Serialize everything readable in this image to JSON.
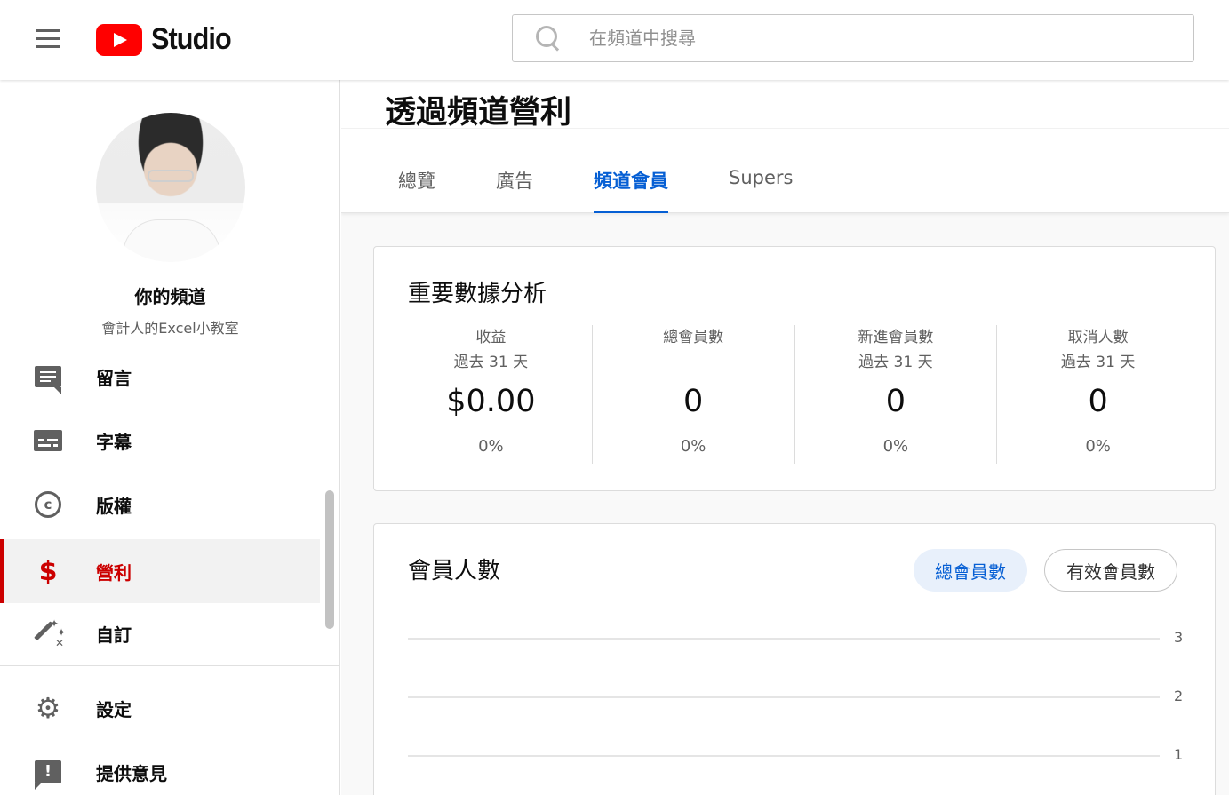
{
  "header": {
    "logo_text": "Studio",
    "search_placeholder": "在頻道中搜尋"
  },
  "sidebar": {
    "channel_label": "你的頻道",
    "channel_name": "會計人的Excel小教室",
    "items": [
      {
        "label": "留言",
        "icon": "comment-icon"
      },
      {
        "label": "字幕",
        "icon": "subtitles-icon"
      },
      {
        "label": "版權",
        "icon": "copyright-icon"
      },
      {
        "label": "營利",
        "icon": "dollar-icon",
        "active": true
      },
      {
        "label": "自訂",
        "icon": "magic-wand-icon"
      },
      {
        "label": "設定",
        "icon": "gear-icon"
      },
      {
        "label": "提供意見",
        "icon": "feedback-icon"
      }
    ]
  },
  "main": {
    "page_title": "透過頻道營利",
    "tabs": [
      {
        "label": "總覽"
      },
      {
        "label": "廣告"
      },
      {
        "label": "頻道會員",
        "active": true
      },
      {
        "label": "Supers"
      }
    ],
    "key_metrics": {
      "title": "重要數據分析",
      "items": [
        {
          "label": "收益",
          "sub": "過去 31 天",
          "value": "$0.00",
          "change": "0%"
        },
        {
          "label": "總會員數",
          "sub": "",
          "value": "0",
          "change": "0%"
        },
        {
          "label": "新進會員數",
          "sub": "過去 31 天",
          "value": "0",
          "change": "0%"
        },
        {
          "label": "取消人數",
          "sub": "過去 31 天",
          "value": "0",
          "change": "0%"
        }
      ]
    },
    "members": {
      "title": "會員人數",
      "chip_total": "總會員數",
      "chip_active": "有效會員數",
      "y_ticks": [
        "3",
        "2",
        "1"
      ]
    }
  },
  "colors": {
    "accent_blue": "#065fd4",
    "active_red": "#cc0000",
    "logo_red": "#ff0000"
  }
}
